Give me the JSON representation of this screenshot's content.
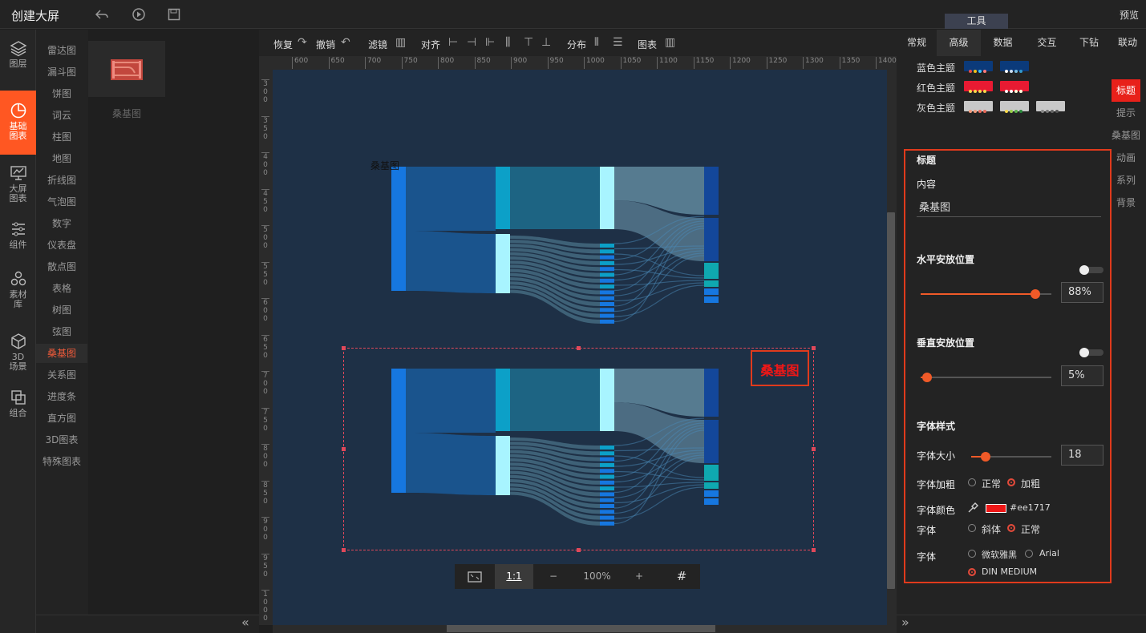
{
  "app": {
    "title": "创建大屏",
    "tool_tab": "工具",
    "preview": "预览"
  },
  "leftnav": [
    {
      "label": "图层",
      "icon": "layers-icon"
    },
    {
      "label": "基础\n图表",
      "icon": "pie-chart-icon",
      "active": true
    },
    {
      "label": "大屏\n图表",
      "icon": "screen-chart-icon"
    },
    {
      "label": "组件",
      "icon": "sliders-icon"
    },
    {
      "label": "素材\n库",
      "icon": "material-icon"
    },
    {
      "label": "3D\n场景",
      "icon": "cube-icon"
    },
    {
      "label": "组合",
      "icon": "combine-icon"
    }
  ],
  "chart_types": [
    "雷达图",
    "漏斗图",
    "饼图",
    "词云",
    "柱图",
    "地图",
    "折线图",
    "气泡图",
    "数字",
    "仪表盘",
    "散点图",
    "表格",
    "树图",
    "弦图",
    "桑基图",
    "关系图",
    "进度条",
    "直方图",
    "3D图表",
    "特殊图表"
  ],
  "selected_type": "桑基图",
  "thumbnail_label": "桑基图",
  "toolbar": {
    "redo": "恢复",
    "undo": "撤销",
    "filter": "滤镜",
    "align": "对齐",
    "distribute": "分布",
    "chart": "图表"
  },
  "ruler_h": [
    "600",
    "650",
    "700",
    "750",
    "800",
    "850",
    "900",
    "950",
    "1000",
    "1050",
    "1100",
    "1150",
    "1200",
    "1250",
    "1300",
    "1350",
    "1400"
  ],
  "ruler_v": [
    "300",
    "350",
    "400",
    "450",
    "500",
    "550",
    "600",
    "650",
    "700",
    "750",
    "800",
    "850",
    "900",
    "950",
    "1000"
  ],
  "canvas": {
    "chart1_title": "桑基图",
    "chart2_title": "桑基图"
  },
  "zoom": {
    "fit": "⛶",
    "one_to_one": "1:1",
    "minus": "−",
    "value": "100%",
    "plus": "+",
    "grid": "#"
  },
  "right_tabs": [
    "常规",
    "高级",
    "数据",
    "交互",
    "下钻",
    "联动"
  ],
  "right_active_tab": "高级",
  "themes": [
    {
      "label": "蓝色主题",
      "swatches": [
        {
          "bg": "#0b3a7a",
          "dots": [
            "#e84b4b",
            "#f0c419",
            "#34c3ff",
            "#ff7a7a"
          ]
        },
        {
          "bg": "#0b3a7a",
          "dots": [
            "#ffffff",
            "#cde",
            "#7bd",
            "#39c"
          ]
        }
      ]
    },
    {
      "label": "红色主题",
      "swatches": [
        {
          "bg": "#e81a32",
          "dots": [
            "#f7d84a",
            "#f7d84a",
            "#f7d84a",
            "#f7d84a"
          ]
        },
        {
          "bg": "#e81a32",
          "dots": [
            "#ffffff",
            "#ffffff",
            "#ffd",
            "#ffd"
          ]
        }
      ]
    },
    {
      "label": "灰色主题",
      "swatches": [
        {
          "bg": "#c8c8c8",
          "dots": [
            "#f29b7c",
            "#f29b7c",
            "#e86a5a",
            "#e86a5a"
          ]
        },
        {
          "bg": "#c8c8c8",
          "dots": [
            "#f7d84a",
            "#9ad04a",
            "#5ab14a",
            "#2a8a3a"
          ]
        },
        {
          "bg": "#c8c8c8",
          "dots": [
            "#888888",
            "#777777",
            "#666666",
            "#555555"
          ]
        }
      ]
    }
  ],
  "side_tabs": [
    "标题",
    "提示",
    "桑基图",
    "动画",
    "系列",
    "背景"
  ],
  "side_active": "标题",
  "props": {
    "section": "标题",
    "content_label": "内容",
    "content_value": "桑基图",
    "h_pos_label": "水平安放位置",
    "h_pos_value": "88%",
    "h_pos_fraction": 0.88,
    "v_pos_label": "垂直安放位置",
    "v_pos_value": "5%",
    "v_pos_fraction": 0.05,
    "font_style_label": "字体样式",
    "font_size_label": "字体大小",
    "font_size_value": "18",
    "font_size_fraction": 0.18,
    "font_weight_label": "字体加粗",
    "weight_normal": "正常",
    "weight_bold": "加粗",
    "font_color_label": "字体颜色",
    "font_color_value": "#ee1717",
    "font_label": "字体",
    "italic": "斜体",
    "normal": "正常",
    "font_family_label": "字体",
    "family_yahei": "微软雅黑",
    "family_arial": "Arial",
    "family_din": "DIN MEDIUM"
  },
  "colors": {
    "accent": "#ff5722",
    "title_red": "#ee1717",
    "canvas_bg": "#1e3046"
  }
}
